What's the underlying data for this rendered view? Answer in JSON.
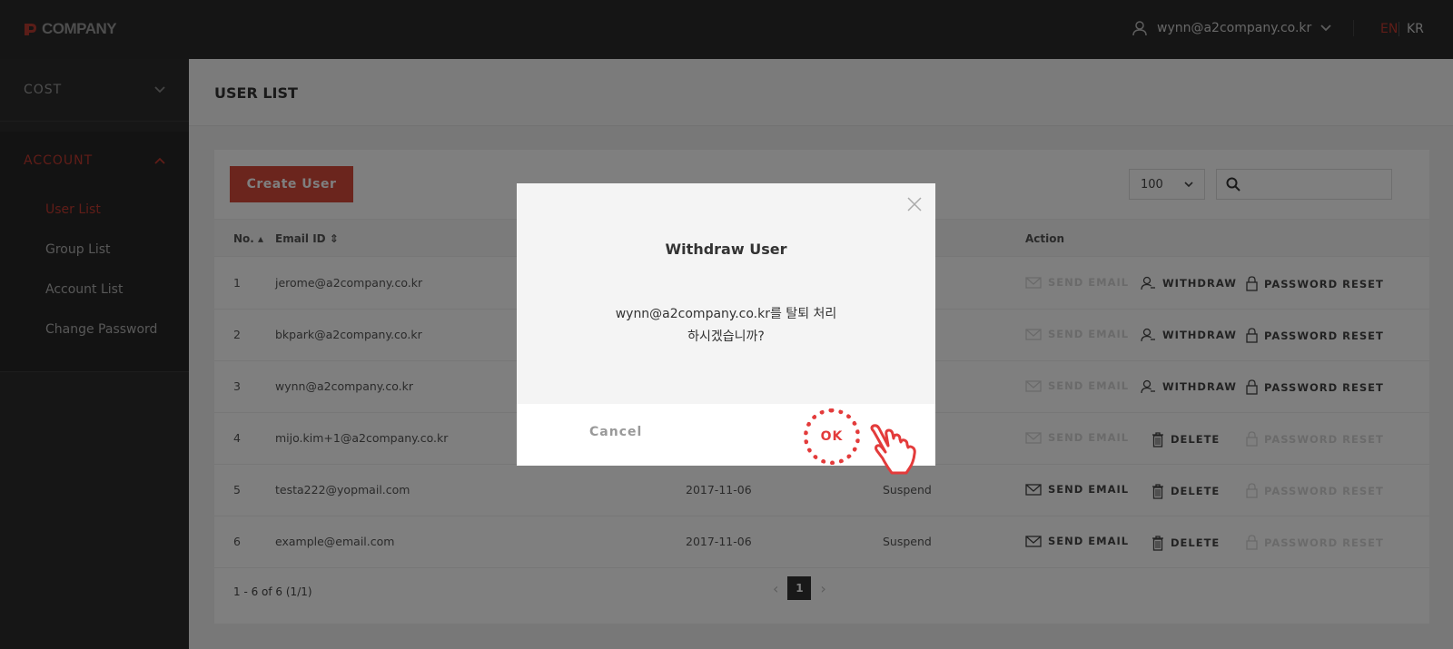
{
  "header": {
    "logo_text": "COMPANY",
    "user_email": "wynn@a2company.co.kr",
    "lang_en": "EN",
    "lang_kr": "KR",
    "active_lang_color": "#c03a30"
  },
  "sidebar": {
    "sections": [
      {
        "label": "COST",
        "expanded": false
      },
      {
        "label": "ACCOUNT",
        "expanded": true
      }
    ],
    "account_items": [
      {
        "label": "User List",
        "active": true
      },
      {
        "label": "Group List",
        "active": false
      },
      {
        "label": "Account List",
        "active": false
      },
      {
        "label": "Change Password",
        "active": false
      }
    ]
  },
  "page": {
    "title": "USER LIST",
    "create_button": "Create User",
    "per_page": "100",
    "search_value": ""
  },
  "table": {
    "columns": [
      "No.",
      "Email ID",
      "Action"
    ],
    "rows": [
      {
        "no": "1",
        "email": "jerome@a2company.co.kr",
        "date": "",
        "status": "",
        "actions": [
          "SEND EMAIL",
          "WITHDRAW",
          "PASSWORD RESET"
        ],
        "send_disabled": true,
        "reset_disabled": false
      },
      {
        "no": "2",
        "email": "bkpark@a2company.co.kr",
        "date": "",
        "status": "",
        "actions": [
          "SEND EMAIL",
          "WITHDRAW",
          "PASSWORD RESET"
        ],
        "send_disabled": true,
        "reset_disabled": false
      },
      {
        "no": "3",
        "email": "wynn@a2company.co.kr",
        "date": "",
        "status": "",
        "actions": [
          "SEND EMAIL",
          "WITHDRAW",
          "PASSWORD RESET"
        ],
        "send_disabled": true,
        "reset_disabled": false
      },
      {
        "no": "4",
        "email": "mijo.kim+1@a2company.co.kr",
        "date": "",
        "status": "",
        "actions": [
          "SEND EMAIL",
          "DELETE",
          "PASSWORD RESET"
        ],
        "send_disabled": true,
        "reset_disabled": true
      },
      {
        "no": "5",
        "email": "testa222@yopmail.com",
        "date": "2017-11-06",
        "status": "Suspend",
        "actions": [
          "SEND EMAIL",
          "DELETE",
          "PASSWORD RESET"
        ],
        "send_disabled": false,
        "reset_disabled": true
      },
      {
        "no": "6",
        "email": "example@email.com",
        "date": "2017-11-06",
        "status": "Suspend",
        "actions": [
          "SEND EMAIL",
          "DELETE",
          "PASSWORD RESET"
        ],
        "send_disabled": false,
        "reset_disabled": true
      }
    ],
    "footer_count": "1 - 6 of 6 (1/1)",
    "current_page": "1"
  },
  "modal": {
    "title": "Withdraw User",
    "message_line1": "wynn@a2company.co.kr를 탈퇴 처리",
    "message_line2": "하시겠습니까?",
    "cancel_label": "Cancel",
    "ok_label": "OK",
    "accent_color": "#e33b3b"
  }
}
